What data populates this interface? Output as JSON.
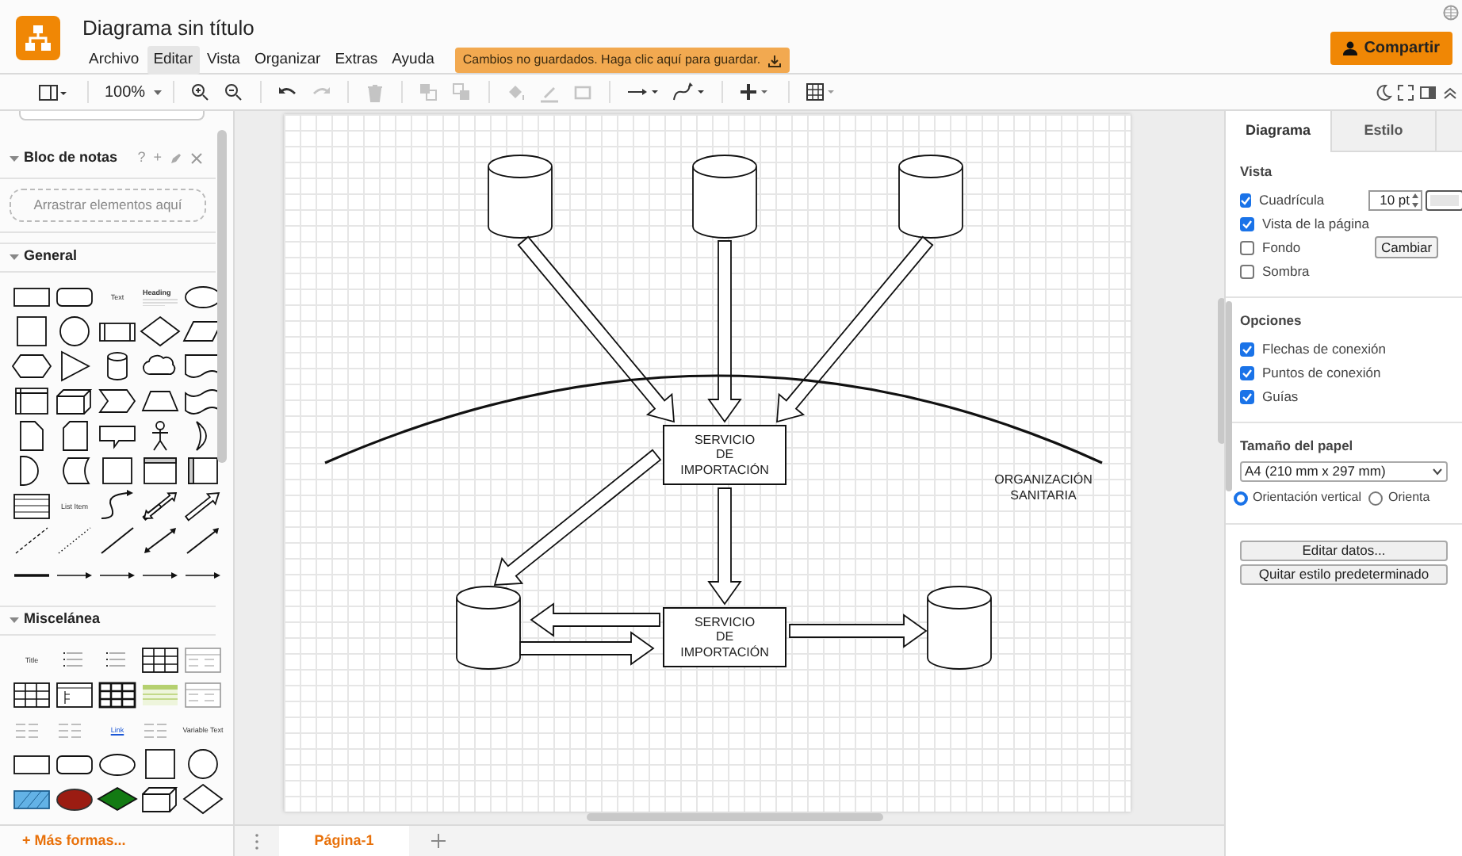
{
  "app": {
    "title": "Diagrama sin título",
    "menu": [
      {
        "label": "Archivo",
        "selected": false
      },
      {
        "label": "Editar",
        "selected": true
      },
      {
        "label": "Vista",
        "selected": false
      },
      {
        "label": "Organizar",
        "selected": false
      },
      {
        "label": "Extras",
        "selected": false
      },
      {
        "label": "Ayuda",
        "selected": false
      }
    ],
    "unsaved_banner": "Cambios no guardados. Haga clic aquí para guardar.",
    "share_button": "Compartir"
  },
  "toolbar": {
    "zoom": "100%",
    "items": [
      {
        "kind": "format",
        "disabled": false
      },
      {
        "kind": "zoomin",
        "disabled": false
      },
      {
        "kind": "zoomout",
        "disabled": false
      },
      {
        "kind": "undo",
        "disabled": false
      },
      {
        "kind": "redo",
        "disabled": true
      },
      {
        "kind": "delete",
        "disabled": true
      },
      {
        "kind": "front",
        "disabled": true
      },
      {
        "kind": "back",
        "disabled": true
      },
      {
        "kind": "fill",
        "disabled": true
      },
      {
        "kind": "linecolor",
        "disabled": true
      },
      {
        "kind": "shadow",
        "disabled": true
      },
      {
        "kind": "connection",
        "disabled": false
      },
      {
        "kind": "waypoint",
        "disabled": false
      },
      {
        "kind": "insert",
        "disabled": false
      },
      {
        "kind": "table",
        "disabled": false
      }
    ],
    "right_items": [
      {
        "kind": "moon"
      },
      {
        "kind": "fullscreen"
      },
      {
        "kind": "panel"
      },
      {
        "kind": "collapse"
      }
    ]
  },
  "sidebar": {
    "scratchpad": {
      "title": "Bloc de notas",
      "actions": [
        "?",
        "+"
      ],
      "drop_hint": "Arrastrar elementos aquí"
    },
    "sections": [
      {
        "title": "General",
        "expanded": true,
        "shapes": [
          {
            "kind": "rect"
          },
          {
            "kind": "rounded"
          },
          {
            "kind": "text",
            "label": "Text"
          },
          {
            "kind": "heading",
            "label": "Heading"
          },
          {
            "kind": "ellipse"
          },
          {
            "kind": "square"
          },
          {
            "kind": "circle"
          },
          {
            "kind": "process"
          },
          {
            "kind": "diamond"
          },
          {
            "kind": "parallelogram"
          },
          {
            "kind": "hexagon"
          },
          {
            "kind": "triangle"
          },
          {
            "kind": "cylinder"
          },
          {
            "kind": "cloud"
          },
          {
            "kind": "document"
          },
          {
            "kind": "storage"
          },
          {
            "kind": "cube"
          },
          {
            "kind": "step"
          },
          {
            "kind": "trapezoid"
          },
          {
            "kind": "tape"
          },
          {
            "kind": "note"
          },
          {
            "kind": "card"
          },
          {
            "kind": "callout"
          },
          {
            "kind": "actor"
          },
          {
            "kind": "or"
          },
          {
            "kind": "and"
          },
          {
            "kind": "datastore"
          },
          {
            "kind": "container"
          },
          {
            "kind": "frame"
          },
          {
            "kind": "swimlane"
          },
          {
            "kind": "list"
          },
          {
            "kind": "text",
            "label": "List Item"
          },
          {
            "kind": "curve"
          },
          {
            "kind": "doublearrow"
          },
          {
            "kind": "arrow"
          },
          {
            "kind": "dashed"
          },
          {
            "kind": "dotted"
          },
          {
            "kind": "line"
          },
          {
            "kind": "bidirectional"
          },
          {
            "kind": "directional"
          },
          {
            "kind": "thickline"
          },
          {
            "kind": "connector"
          },
          {
            "kind": "connector"
          },
          {
            "kind": "connector"
          },
          {
            "kind": "connector"
          }
        ]
      },
      {
        "title": "Miscelánea",
        "expanded": true,
        "shapes": [
          {
            "kind": "text",
            "label": "Title"
          },
          {
            "kind": "bullets"
          },
          {
            "kind": "bullets"
          },
          {
            "kind": "table"
          },
          {
            "kind": "tablelines"
          },
          {
            "kind": "table"
          },
          {
            "kind": "tree"
          },
          {
            "kind": "darktable"
          },
          {
            "kind": "greentable"
          },
          {
            "kind": "tablelines"
          },
          {
            "kind": "textblock"
          },
          {
            "kind": "textblock"
          },
          {
            "kind": "link",
            "label": "Link"
          },
          {
            "kind": "textblock"
          },
          {
            "kind": "text",
            "label": "Variable Text"
          },
          {
            "kind": "rect"
          },
          {
            "kind": "rounded"
          },
          {
            "kind": "ellipse"
          },
          {
            "kind": "square"
          },
          {
            "kind": "circle"
          },
          {
            "kind": "hatched"
          },
          {
            "kind": "redcloud"
          },
          {
            "kind": "greendiamond"
          },
          {
            "kind": "cube"
          },
          {
            "kind": "diamond"
          }
        ]
      }
    ],
    "more_shapes": "+ Más formas..."
  },
  "diagram": {
    "nodes": [
      {
        "kind": "cylinder"
      },
      {
        "kind": "cylinder"
      },
      {
        "kind": "cylinder"
      },
      {
        "kind": "process",
        "label": "SERVICIO\nDE\nIMPORTACIÓN"
      },
      {
        "kind": "process",
        "label": "SERVICIO\nDE\nIMPORTACIÓN"
      },
      {
        "kind": "cylinder"
      },
      {
        "kind": "cylinder"
      },
      {
        "kind": "text",
        "label": "ORGANIZACIÓN\nSANITARIA"
      }
    ],
    "connectors": [
      {
        "kind": "block-arrow"
      },
      {
        "kind": "block-arrow"
      },
      {
        "kind": "block-arrow"
      },
      {
        "kind": "block-arrow"
      },
      {
        "kind": "block-arrow"
      },
      {
        "kind": "block-arrow"
      },
      {
        "kind": "block-arrow"
      },
      {
        "kind": "block-arrow"
      },
      {
        "kind": "arc"
      }
    ]
  },
  "pages": {
    "tabs": [
      {
        "label": "Página-1",
        "selected": true
      }
    ]
  },
  "format_panel": {
    "tabs": [
      {
        "label": "Diagrama",
        "selected": true
      },
      {
        "label": "Estilo",
        "selected": false
      }
    ],
    "view": {
      "title": "Vista",
      "options": [
        {
          "label": "Cuadrícula",
          "checked": true
        },
        {
          "label": "Vista de la página",
          "checked": true
        },
        {
          "label": "Fondo",
          "checked": false
        },
        {
          "label": "Sombra",
          "checked": false
        }
      ],
      "grid_size": "10 pt",
      "change_button": "Cambiar"
    },
    "options": {
      "title": "Opciones",
      "options": [
        {
          "label": "Flechas de conexión",
          "checked": true
        },
        {
          "label": "Puntos de conexión",
          "checked": true
        },
        {
          "label": "Guías",
          "checked": true
        }
      ]
    },
    "paper": {
      "title": "Tamaño del papel",
      "size": "A4 (210 mm x 297 mm)",
      "orientations": [
        {
          "label": "Orientación vertical",
          "selected": true
        },
        {
          "label": "Orienta",
          "selected": false
        }
      ]
    },
    "buttons": [
      "Editar datos...",
      "Quitar estilo predeterminado"
    ]
  }
}
